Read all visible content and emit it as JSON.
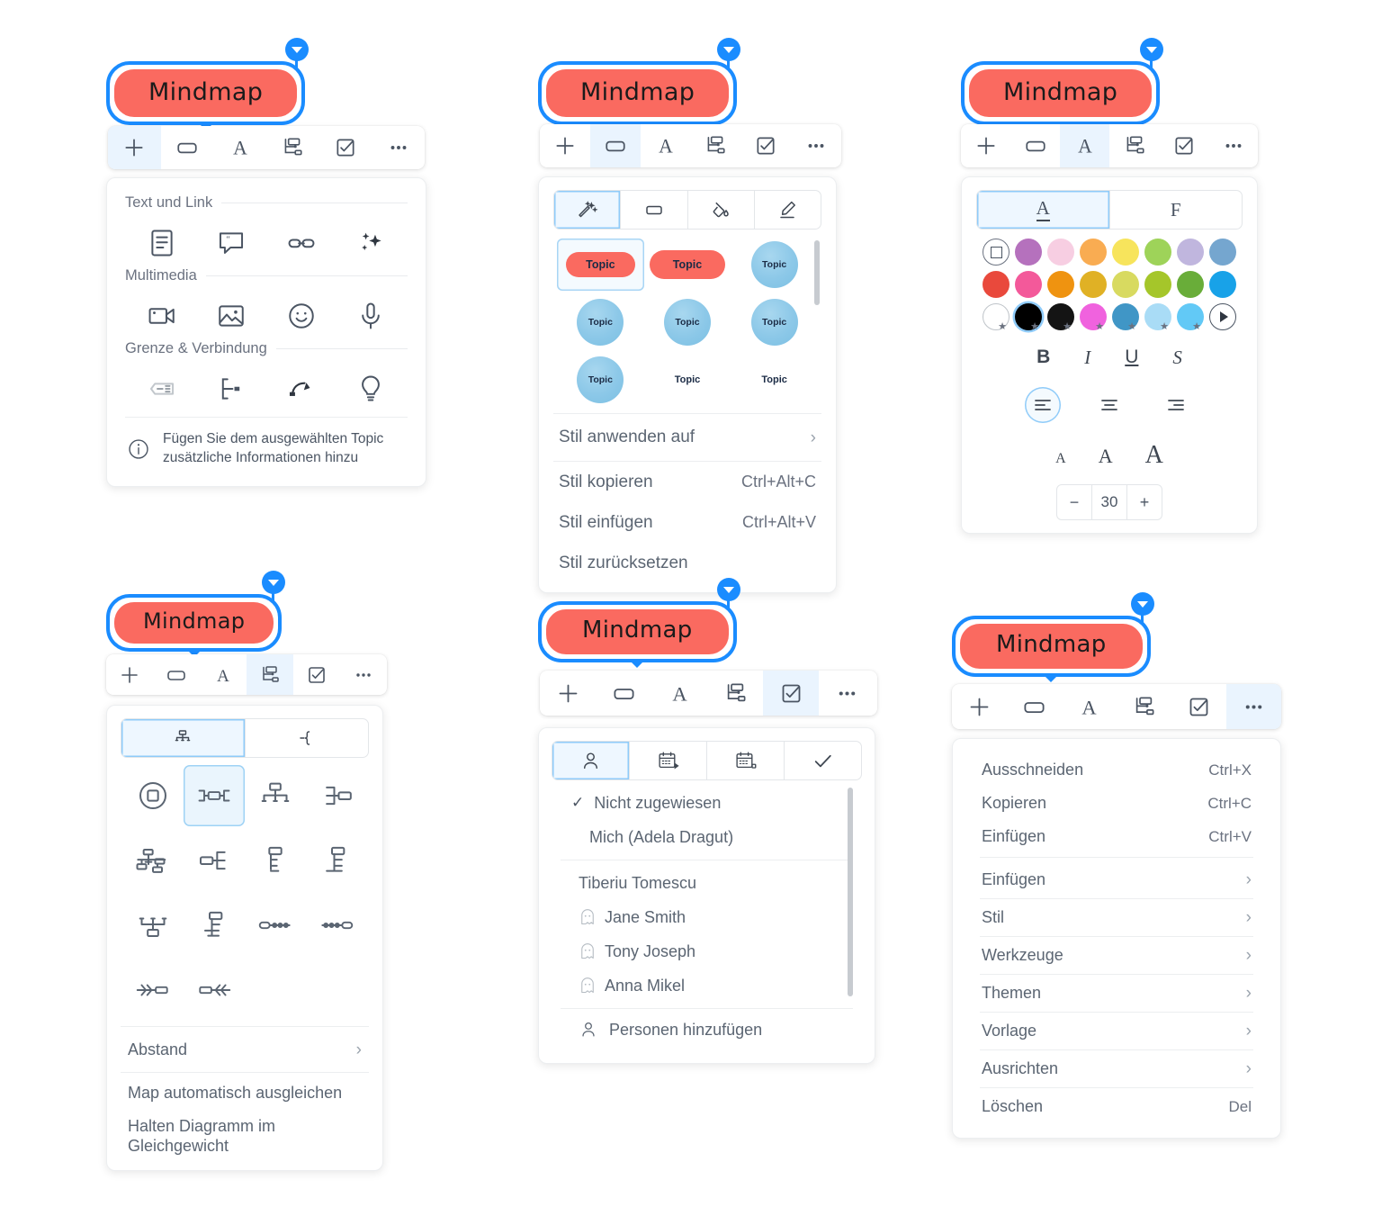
{
  "node": {
    "label": "Mindmap"
  },
  "toolbar": {
    "buttons": [
      {
        "name": "add-icon",
        "title": "Hinzufügen"
      },
      {
        "name": "shape-icon",
        "title": "Stil"
      },
      {
        "name": "text-format-icon",
        "title": "Text"
      },
      {
        "name": "layout-icon",
        "title": "Layout"
      },
      {
        "name": "task-icon",
        "title": "Aufgabe"
      },
      {
        "name": "more-icon",
        "title": "Mehr"
      }
    ]
  },
  "panel_insert": {
    "sections": [
      {
        "title": "Text und Link",
        "icons": [
          "note-icon",
          "comment-icon",
          "link-icon",
          "sparkle-ai-icon"
        ]
      },
      {
        "title": "Multimedia",
        "icons": [
          "video-icon",
          "image-icon",
          "emoji-icon",
          "microphone-icon"
        ]
      },
      {
        "title": "Grenze & Verbindung",
        "icons": [
          "summary-icon",
          "boundary-icon",
          "relationship-icon",
          "callout-icon"
        ]
      }
    ],
    "info": "Fügen Sie dem ausgewählten Topic zusätzliche Informationen hinzu"
  },
  "panel_style": {
    "tabs": [
      {
        "name": "magic-style-icon",
        "active": true
      },
      {
        "name": "shape-icon",
        "active": false
      },
      {
        "name": "fill-bucket-icon",
        "active": false
      },
      {
        "name": "pencil-line-icon",
        "active": false
      }
    ],
    "swatches": [
      {
        "kind": "pill-red",
        "label": "Topic",
        "selected": true
      },
      {
        "kind": "pill-red-wide",
        "label": "Topic",
        "selected": false
      },
      {
        "kind": "circle-blue",
        "label": "Topic",
        "selected": false
      },
      {
        "kind": "circle-blue",
        "label": "Topic",
        "selected": false
      },
      {
        "kind": "circle-blue",
        "label": "Topic",
        "selected": false
      },
      {
        "kind": "circle-blue",
        "label": "Topic",
        "selected": false
      },
      {
        "kind": "circle-blue",
        "label": "Topic",
        "selected": false
      },
      {
        "kind": "plain",
        "label": "Topic",
        "selected": false
      },
      {
        "kind": "plain",
        "label": "Topic",
        "selected": false
      }
    ],
    "menu": [
      {
        "label": "Stil anwenden auf",
        "shortcut": "",
        "submenu": true
      },
      {
        "label": "Stil kopieren",
        "shortcut": "Ctrl+Alt+C",
        "submenu": false
      },
      {
        "label": "Stil einfügen",
        "shortcut": "Ctrl+Alt+V",
        "submenu": false
      },
      {
        "label": "Stil zurücksetzen",
        "shortcut": "",
        "submenu": false
      }
    ]
  },
  "panel_text": {
    "tabs": [
      {
        "label": "A",
        "name": "font-color-tab",
        "active": true
      },
      {
        "label": "F",
        "name": "font-family-tab",
        "active": false
      }
    ],
    "palette_row1": [
      "none",
      "#b571bd",
      "#f7cee2",
      "#f9ac52",
      "#f7e45c",
      "#9ed359",
      "#c0b6de",
      "#75a6cf"
    ],
    "palette_row2": [
      "#e9493c",
      "#f3599a",
      "#ef9310",
      "#e0b125",
      "#d8da60",
      "#a5c62a",
      "#69ad39",
      "#18a2e8"
    ],
    "palette_row3": [
      "#ffffff",
      "#000000",
      "#141414",
      "#f062de",
      "#4096c6",
      "#a9dcf6",
      "#62c9f6",
      "more"
    ],
    "selected_color": "#000000",
    "format_buttons": [
      "B",
      "I",
      "U",
      "S"
    ],
    "alignment": [
      {
        "name": "align-left-icon",
        "active": true
      },
      {
        "name": "align-center-icon",
        "active": false
      },
      {
        "name": "align-right-icon",
        "active": false
      }
    ],
    "size_presets": [
      "A",
      "A",
      "A"
    ],
    "font_size": "30",
    "stepper_minus": "−",
    "stepper_plus": "+"
  },
  "panel_layout": {
    "tabs": [
      {
        "name": "structure-tree-icon",
        "active": true
      },
      {
        "name": "branch-bracket-icon",
        "active": false
      }
    ],
    "layouts": [
      {
        "name": "layout-none-icon",
        "selected": false
      },
      {
        "name": "layout-balanced-map-icon",
        "selected": true
      },
      {
        "name": "layout-org-chart-down-icon",
        "selected": false
      },
      {
        "name": "layout-logic-right-icon",
        "selected": false
      },
      {
        "name": "layout-fishbone-icon",
        "selected": false
      },
      {
        "name": "layout-logic-left-icon",
        "selected": false
      },
      {
        "name": "layout-tree-right-icon",
        "selected": false
      },
      {
        "name": "layout-tree-left-icon",
        "selected": false
      },
      {
        "name": "layout-org-chart-up-icon",
        "selected": false
      },
      {
        "name": "layout-tree-mixed-icon",
        "selected": false
      },
      {
        "name": "layout-timeline-right-icon",
        "selected": false
      },
      {
        "name": "layout-timeline-left-icon",
        "selected": false
      },
      {
        "name": "layout-fishbone-right-icon",
        "selected": false
      },
      {
        "name": "layout-fishbone-left-icon",
        "selected": false
      }
    ],
    "menu": [
      {
        "label": "Abstand",
        "submenu": true
      },
      {
        "label": "Map automatisch ausgleichen",
        "submenu": false
      },
      {
        "label": "Halten Diagramm im Gleichgewicht",
        "submenu": false
      }
    ]
  },
  "panel_task": {
    "tabs": [
      {
        "name": "assignee-person-icon",
        "active": true
      },
      {
        "name": "start-date-icon",
        "active": false
      },
      {
        "name": "end-date-icon",
        "active": false
      },
      {
        "name": "progress-check-icon",
        "active": false
      }
    ],
    "items": [
      {
        "label": "Nicht zugewiesen",
        "checked": true,
        "avatar": false
      },
      {
        "label": "Mich (Adela Dragut)",
        "checked": false,
        "avatar": false
      },
      {
        "label": "Tiberiu Tomescu",
        "checked": false,
        "avatar": false
      },
      {
        "label": "Jane Smith",
        "checked": false,
        "avatar": true
      },
      {
        "label": "Tony Joseph",
        "checked": false,
        "avatar": true
      },
      {
        "label": "Anna Mikel",
        "checked": false,
        "avatar": true
      }
    ],
    "add_people": "Personen hinzufügen"
  },
  "panel_more": {
    "items": [
      {
        "label": "Ausschneiden",
        "shortcut": "Ctrl+X",
        "submenu": false,
        "divider_after": false
      },
      {
        "label": "Kopieren",
        "shortcut": "Ctrl+C",
        "submenu": false,
        "divider_after": false
      },
      {
        "label": "Einfügen",
        "shortcut": "Ctrl+V",
        "submenu": false,
        "divider_after": true
      },
      {
        "label": "Einfügen",
        "shortcut": "",
        "submenu": true,
        "divider_after": true
      },
      {
        "label": "Stil",
        "shortcut": "",
        "submenu": true,
        "divider_after": true
      },
      {
        "label": "Werkzeuge",
        "shortcut": "",
        "submenu": true,
        "divider_after": true
      },
      {
        "label": "Themen",
        "shortcut": "",
        "submenu": true,
        "divider_after": true
      },
      {
        "label": "Vorlage",
        "shortcut": "",
        "submenu": true,
        "divider_after": true
      },
      {
        "label": "Ausrichten",
        "shortcut": "",
        "submenu": true,
        "divider_after": true
      },
      {
        "label": "Löschen",
        "shortcut": "Del",
        "submenu": false,
        "divider_after": false
      }
    ]
  },
  "colors": {
    "node_fill": "#fa6a60",
    "selection_blue": "#1a8cff",
    "active_tab_bg": "#eaf4fe"
  }
}
